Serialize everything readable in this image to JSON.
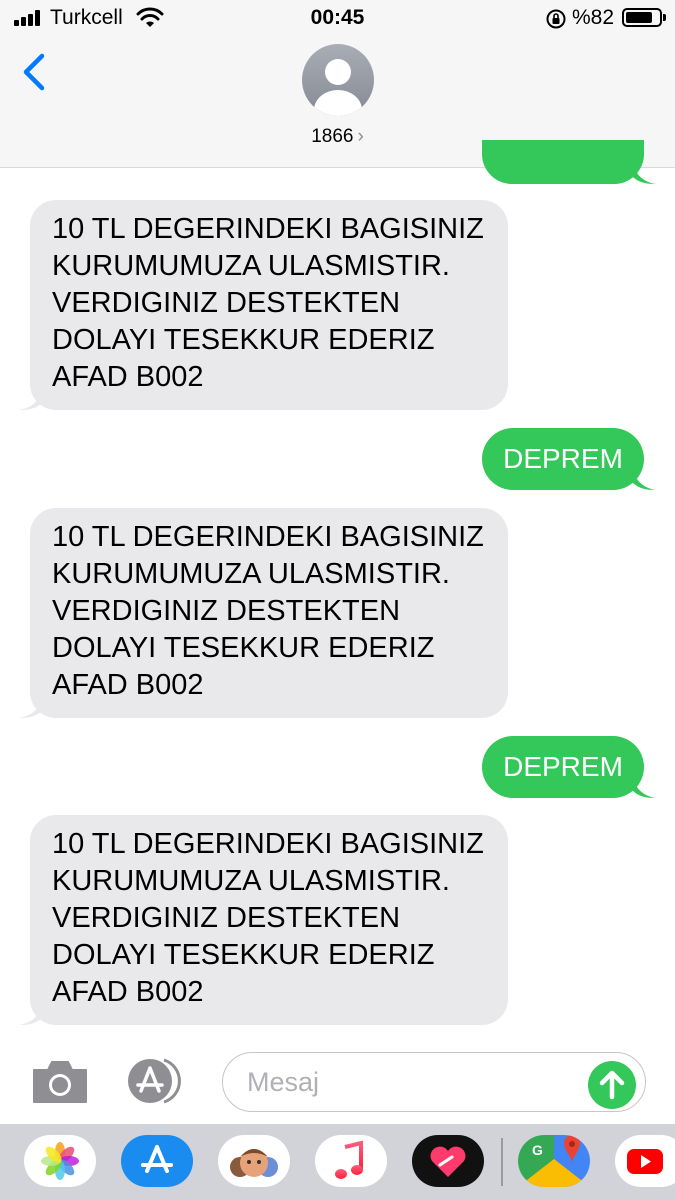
{
  "status_bar": {
    "carrier": "Turkcell",
    "time": "00:45",
    "battery_percent": "%82",
    "battery_level": 0.82
  },
  "header": {
    "contact_name": "1866",
    "chevron": "›"
  },
  "messages": [
    {
      "direction": "incoming",
      "text": "10 TL DEGERINDEKI BAGISINIZ KURUMUMUZA ULASMISTIR. VERDIGINIZ DESTEKTEN DOLAYI TESEKKUR EDERIZ AFAD B002"
    },
    {
      "direction": "outgoing",
      "text": "DEPREM"
    },
    {
      "direction": "incoming",
      "text": "10 TL DEGERINDEKI BAGISINIZ KURUMUMUZA ULASMISTIR. VERDIGINIZ DESTEKTEN DOLAYI TESEKKUR EDERIZ AFAD B002"
    },
    {
      "direction": "outgoing",
      "text": "DEPREM"
    },
    {
      "direction": "incoming",
      "text": "10 TL DEGERINDEKI BAGISINIZ KURUMUMUZA ULASMISTIR. VERDIGINIZ DESTEKTEN DOLAYI TESEKKUR EDERIZ AFAD B002"
    }
  ],
  "input": {
    "placeholder": "Mesaj"
  },
  "app_drawer": [
    {
      "name": "photos-app-icon"
    },
    {
      "name": "app-store-app-icon"
    },
    {
      "name": "memoji-app-icon"
    },
    {
      "name": "music-app-icon"
    },
    {
      "name": "digital-touch-app-icon"
    },
    {
      "name": "google-maps-app-icon"
    },
    {
      "name": "youtube-app-icon"
    }
  ],
  "colors": {
    "outgoing_bubble": "#34c759",
    "incoming_bubble": "#e9e9eb",
    "accent_blue": "#007aff"
  }
}
